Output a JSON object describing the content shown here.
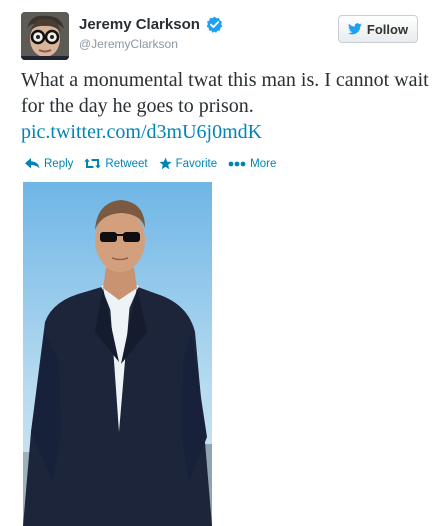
{
  "user": {
    "name": "Jeremy Clarkson",
    "handle": "@JeremyClarkson"
  },
  "follow_button": {
    "label": "Follow",
    "icon": "twitter-bird-icon"
  },
  "tweet": {
    "text": "What a monumental twat this man is. I cannot wait for the day he goes to prison.",
    "link": "pic.twitter.com/d3mU6j0mdK"
  },
  "actions": [
    {
      "label": "Reply",
      "icon": "reply-icon"
    },
    {
      "label": "Retweet",
      "icon": "retweet-icon"
    },
    {
      "label": "Favorite",
      "icon": "star-icon"
    },
    {
      "label": "More",
      "icon": "more-dots-icon"
    }
  ],
  "colors": {
    "link": "#0084b4",
    "name": "#292f33",
    "handle": "#8899a6",
    "verified": "#1da1f2"
  }
}
